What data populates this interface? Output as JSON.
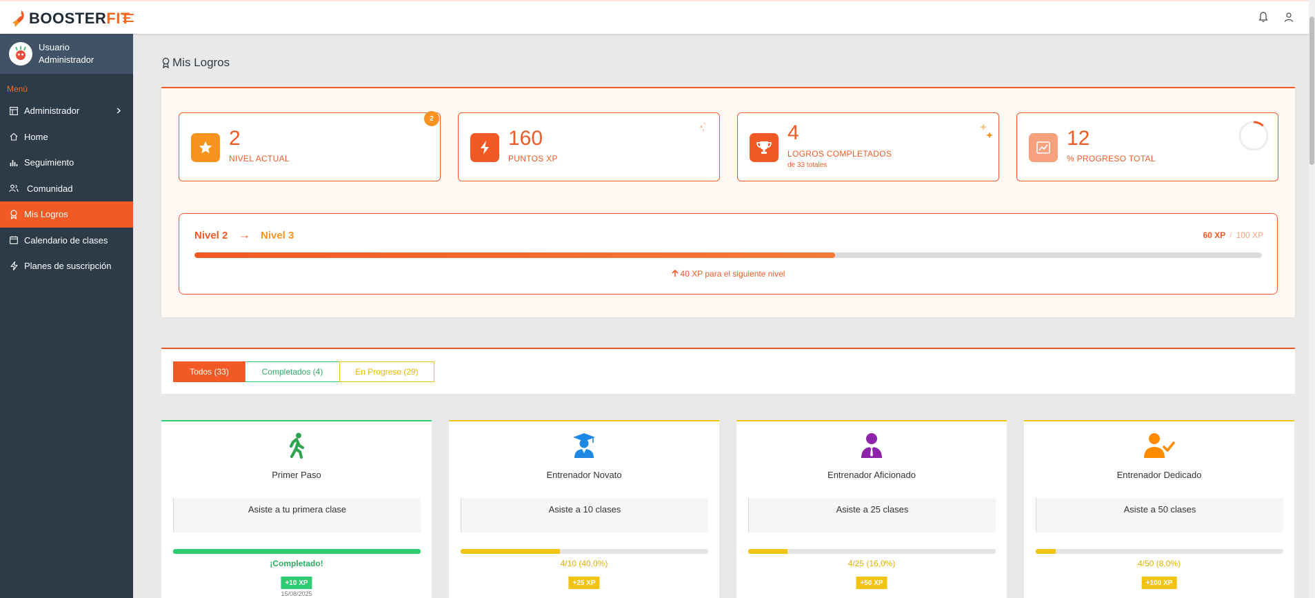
{
  "brand": {
    "part1": "BOOSTER",
    "part2": "FIT"
  },
  "user": {
    "line1": "Usuario",
    "line2": "Administrador"
  },
  "sidebar": {
    "menu_label": "Menú",
    "items": [
      {
        "label": "Administrador",
        "icon": "layout-icon"
      },
      {
        "label": "Home",
        "icon": "home-icon"
      },
      {
        "label": "Seguimiento",
        "icon": "bar-chart-icon"
      },
      {
        "label": "Comunidad",
        "icon": "users-icon"
      },
      {
        "label": "Mis Logros",
        "icon": "award-icon",
        "active": true
      },
      {
        "label": "Calendario de clases",
        "icon": "calendar-icon"
      },
      {
        "label": "Planes de suscripción",
        "icon": "lightning-icon"
      }
    ]
  },
  "page": {
    "title": "Mis Logros"
  },
  "stats": [
    {
      "value": "2",
      "label": "NIVEL ACTUAL",
      "badge": "2",
      "icon": "star-icon",
      "color": "#f7931e"
    },
    {
      "value": "160",
      "label": "PUNTOS XP",
      "icon": "lightning-icon",
      "color": "#f15a24"
    },
    {
      "value": "4",
      "label": "LOGROS COMPLETADOS",
      "sub": "de 33 totales",
      "icon": "trophy-icon",
      "color": "#f15a24"
    },
    {
      "value": "12",
      "label": "% PROGRESO TOTAL",
      "icon": "chart-icon",
      "color": "#f6a07e"
    }
  ],
  "level": {
    "from": "Nivel 2",
    "arrow": "→",
    "to": "Nivel 3",
    "current_xp": "60 XP",
    "separator": "/",
    "max_xp": "100 XP",
    "progress_percent": 60,
    "note": "40 XP para el siguiente nivel"
  },
  "filters": {
    "all": "Todos (33)",
    "completed": "Completados (4)",
    "in_progress": "En Progreso (29)"
  },
  "achievements": [
    {
      "title": "Primer Paso",
      "description": "Asiste a tu primera clase",
      "status": "¡Completado!",
      "xp": "+10 XP",
      "date": "15/08/2025",
      "progress_percent": 100,
      "color": "#2ecc71",
      "icon": "walking-icon"
    },
    {
      "title": "Entrenador Novato",
      "description": "Asiste a 10 clases",
      "status": "4/10 (40,0%)",
      "xp": "+25 XP",
      "progress_percent": 40,
      "color": "#f1c40f",
      "icon": "graduate-icon"
    },
    {
      "title": "Entrenador Aficionado",
      "description": "Asiste a 25 clases",
      "status": "4/25 (16,0%)",
      "xp": "+50 XP",
      "progress_percent": 16,
      "color": "#f1c40f",
      "icon": "person-tie-icon"
    },
    {
      "title": "Entrenador Dedicado",
      "description": "Asiste a 50 clases",
      "status": "4/50 (8,0%)",
      "xp": "+100 XP",
      "progress_percent": 8,
      "color": "#f1c40f",
      "icon": "user-check-icon"
    }
  ]
}
